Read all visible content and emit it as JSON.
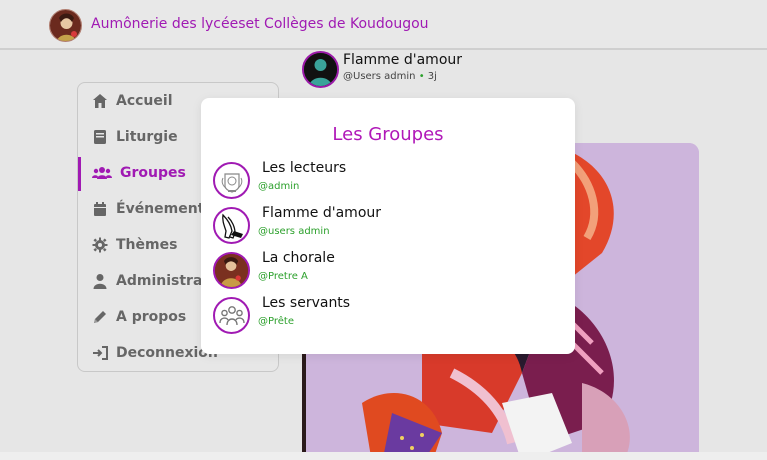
{
  "header": {
    "title": "Aumônerie des lycéeset Collèges de Koudougou",
    "logo_icon": "saint-portrait-logo"
  },
  "sidebar": {
    "items": [
      {
        "label": "Accueil",
        "icon": "home-icon",
        "active": false
      },
      {
        "label": "Liturgie",
        "icon": "book-icon",
        "active": false
      },
      {
        "label": "Groupes",
        "icon": "users-icon",
        "active": true
      },
      {
        "label": "Événements",
        "icon": "calendar-icon",
        "active": false
      },
      {
        "label": "Thèmes",
        "icon": "gear-icon",
        "active": false
      },
      {
        "label": "Administratio",
        "icon": "user-icon",
        "active": false
      },
      {
        "label": "A propos",
        "icon": "pencil-icon",
        "active": false
      },
      {
        "label": "Deconnexion",
        "icon": "logout-icon",
        "active": false
      }
    ]
  },
  "post": {
    "author": "Flamme d'amour",
    "handle": "@Users admin",
    "separator": "•",
    "time": "3j"
  },
  "modal": {
    "title": "Les Groupes",
    "groups": [
      {
        "name": "Les lecteurs",
        "handle": "@admin",
        "icon": "emblem-icon"
      },
      {
        "name": "Flamme d'amour",
        "handle": "@users admin",
        "icon": "praying-hands-icon"
      },
      {
        "name": "La chorale",
        "handle": "@Pretre A",
        "icon": "saint-portrait-icon"
      },
      {
        "name": "Les servants",
        "handle": "@Prête",
        "icon": "group-icon"
      }
    ]
  },
  "colors": {
    "accent": "#a01ab3",
    "handle_green": "#2ca02c",
    "background": "#e6e6e6"
  }
}
